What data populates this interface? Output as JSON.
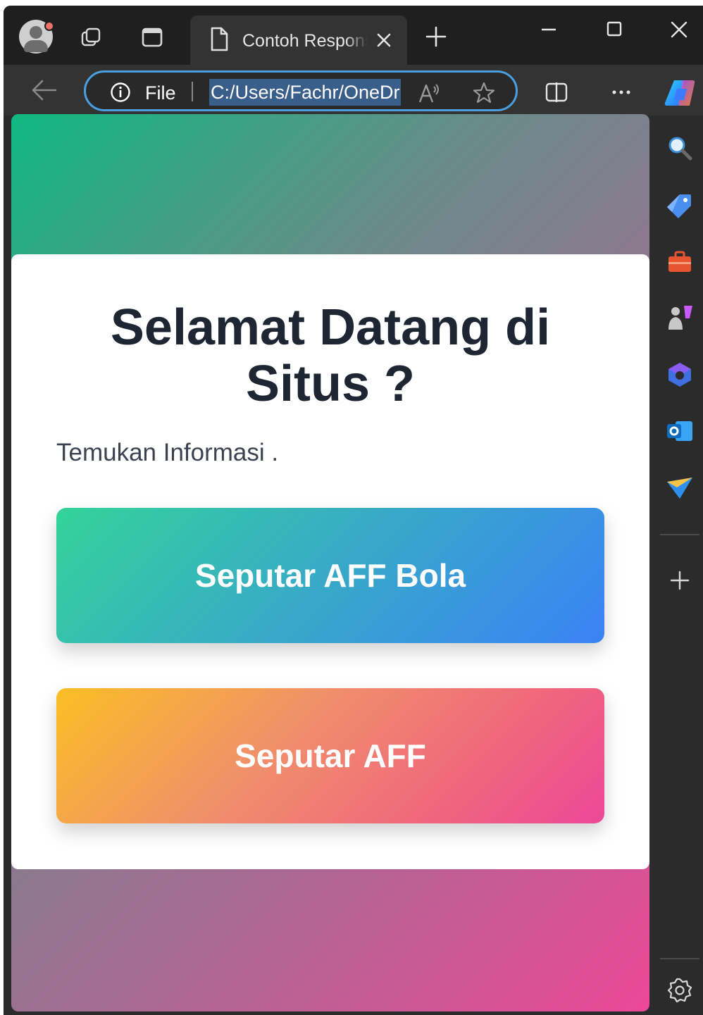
{
  "browser": {
    "tab_title": "Contoh Responsive",
    "address": {
      "scheme_label": "File",
      "url": "C:/Users/Fachr/OneDrive/Desktop/index.html"
    },
    "sidebar_icons": [
      "search-icon",
      "shopping-tag-icon",
      "tools-icon",
      "games-icon",
      "office-icon",
      "outlook-icon",
      "drop-icon",
      "add-icon",
      "settings-icon"
    ],
    "colors": {
      "accent": "#4b9fe1",
      "chrome": "#2b2b2b"
    }
  },
  "page": {
    "title": "Selamat Datang di Situs ?",
    "subtitle": "Temukan Informasi .",
    "buttons": [
      {
        "label": "Seputar AFF Bola",
        "gradient": [
          "#34d399",
          "#3b82f6"
        ]
      },
      {
        "label": "Seputar AFF",
        "gradient": [
          "#fbbf24",
          "#ec4899"
        ]
      }
    ],
    "background_gradient": [
      "#10b981",
      "#ec4899"
    ]
  }
}
